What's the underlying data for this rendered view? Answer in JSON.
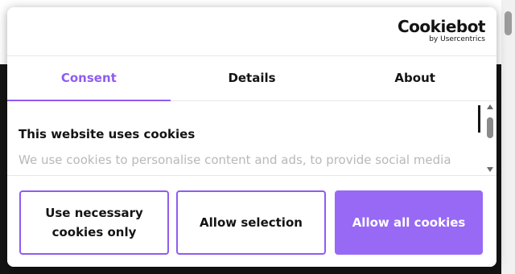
{
  "brand": {
    "name": "Cookiebot",
    "byline": "by Usercentrics"
  },
  "tabs": [
    {
      "label": "Consent",
      "active": true
    },
    {
      "label": "Details",
      "active": false
    },
    {
      "label": "About",
      "active": false
    }
  ],
  "content": {
    "heading": "This website uses cookies",
    "description": "We use cookies to personalise content and ads, to provide social media"
  },
  "buttons": {
    "necessary": "Use necessary cookies only",
    "selection": "Allow selection",
    "all": "Allow all cookies"
  },
  "colors": {
    "accent": "#8f5cf0",
    "accent_fill": "#9769f5",
    "text": "#141414"
  }
}
